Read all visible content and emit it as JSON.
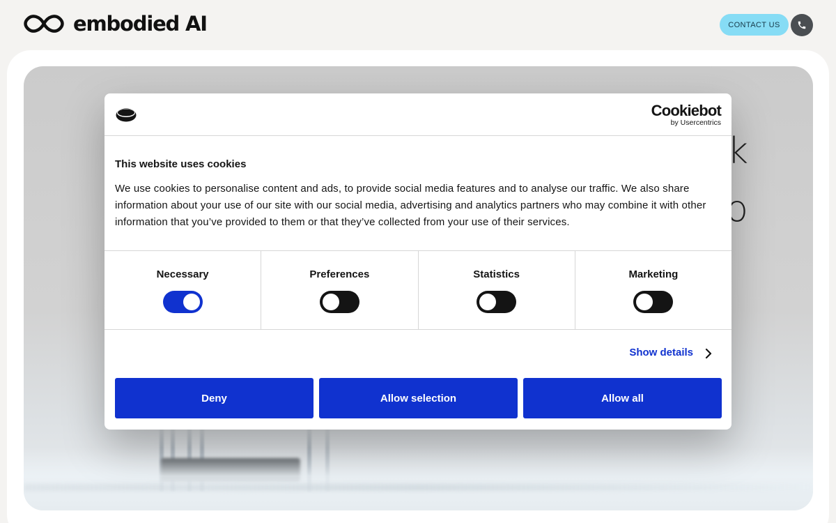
{
  "header": {
    "brand": "embodied AI",
    "contact_label": "CONTACT US"
  },
  "hero": {
    "partial_text_1": "k",
    "partial_text_2": "o"
  },
  "cookie_dialog": {
    "provider_name": "Cookiebot",
    "provider_sub": "by Usercentrics",
    "title": "This website uses cookies",
    "body": "We use cookies to personalise content and ads, to provide social media features and to analyse our traffic. We also share information about your use of our site with our social media, advertising and analytics partners who may combine it with other information that you’ve provided to them or that they’ve collected from your use of their services.",
    "categories": [
      {
        "label": "Necessary",
        "enabled": true
      },
      {
        "label": "Preferences",
        "enabled": false
      },
      {
        "label": "Statistics",
        "enabled": false
      },
      {
        "label": "Marketing",
        "enabled": false
      }
    ],
    "show_details": "Show details",
    "buttons": {
      "deny": "Deny",
      "allow_selection": "Allow selection",
      "allow_all": "Allow all"
    }
  },
  "colors": {
    "accent": "#1032cf",
    "contact_button": "#86dcf5",
    "phone_button": "#4a4e52",
    "page_background": "#f4f3f1"
  },
  "icons": [
    "infinity-logo-icon",
    "phone-icon",
    "cookie-icon",
    "chevron-right-icon"
  ]
}
